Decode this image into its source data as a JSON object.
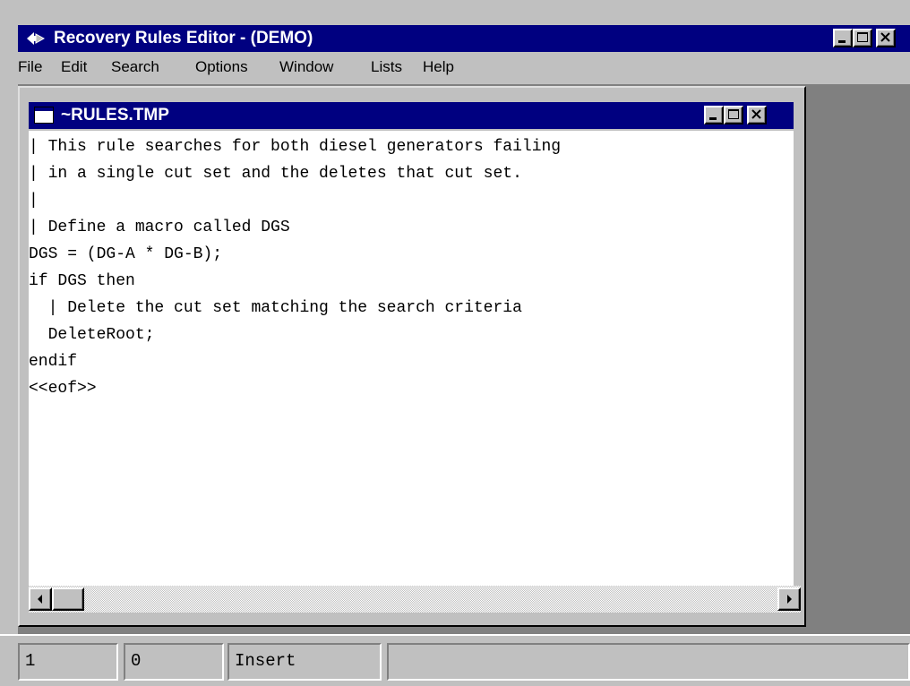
{
  "app": {
    "title": "Recovery Rules Editor - (DEMO)",
    "icon": "recovery-app-icon"
  },
  "menu": [
    "File",
    "Edit",
    "Search",
    "Options",
    "Window",
    "Lists",
    "Help"
  ],
  "child_window": {
    "title": "~RULES.TMP",
    "icon": "document-window-icon"
  },
  "editor": {
    "lines": [
      "| This rule searches for both diesel generators failing",
      "| in a single cut set and the deletes that cut set.",
      "|",
      "| Define a macro called DGS",
      "DGS = (DG-A * DG-B);",
      "if DGS then",
      "  | Delete the cut set matching the search criteria",
      "  DeleteRoot;",
      "endif",
      "<<eof>>"
    ]
  },
  "statusbar": {
    "line": "1",
    "column": "0",
    "mode": "Insert",
    "message": ""
  },
  "colors": {
    "titlebar": "#000080",
    "face": "#c0c0c0",
    "mdi_background": "#808080",
    "editor_background": "#ffffff"
  }
}
